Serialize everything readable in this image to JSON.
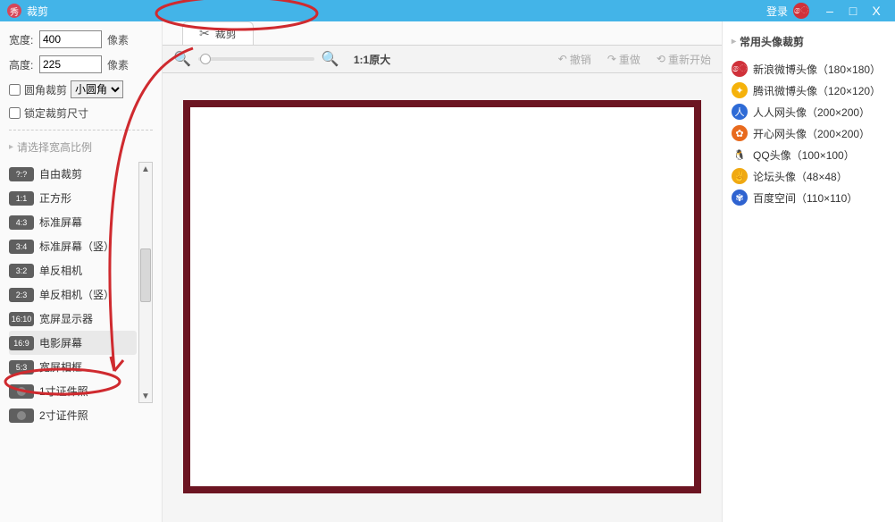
{
  "titleBar": {
    "appTitle": "裁剪",
    "login": "登录"
  },
  "winBtns": {
    "min": "–",
    "max": "□",
    "close": "X"
  },
  "left": {
    "width": {
      "label": "宽度:",
      "value": "400",
      "unit": "像素"
    },
    "height": {
      "label": "高度:",
      "value": "225",
      "unit": "像素"
    },
    "roundCorner": {
      "label": "圆角裁剪",
      "selectValue": "小圆角"
    },
    "lock": {
      "label": "锁定裁剪尺寸"
    },
    "ratioHead": "请选择宽高比例",
    "ratioItems": [
      {
        "badge": "?:?",
        "label": "自由裁剪",
        "selected": false
      },
      {
        "badge": "1:1",
        "label": "正方形",
        "selected": false
      },
      {
        "badge": "4:3",
        "label": "标准屏幕",
        "selected": false
      },
      {
        "badge": "3:4",
        "label": "标准屏幕（竖）",
        "selected": false
      },
      {
        "badge": "3:2",
        "label": "单反相机",
        "selected": false
      },
      {
        "badge": "2:3",
        "label": "单反相机（竖）",
        "selected": false
      },
      {
        "badge": "16:10",
        "label": "宽屏显示器",
        "selected": false
      },
      {
        "badge": "16:9",
        "label": "电影屏幕",
        "selected": true
      },
      {
        "badge": "5:3",
        "label": "宽屏相框",
        "selected": false
      },
      {
        "badge": "cam",
        "label": "1寸证件照",
        "selected": false
      },
      {
        "badge": "cam",
        "label": "2寸证件照",
        "selected": false
      }
    ]
  },
  "center": {
    "tabLabel": "裁剪",
    "zoomLabel": "1:1原大",
    "undo": "撤销",
    "redo": "重做",
    "restart": "重新开始"
  },
  "right": {
    "head": "常用头像裁剪",
    "presets": [
      {
        "color": "#d0313a",
        "glyph": "ෙ",
        "label": "新浪微博头像（180×180）"
      },
      {
        "color": "#f5b20b",
        "glyph": "✦",
        "label": "腾讯微博头像（120×120）"
      },
      {
        "color": "#2e6bd6",
        "glyph": "人",
        "label": "人人网头像（200×200）"
      },
      {
        "color": "#e86a1e",
        "glyph": "✿",
        "label": "开心网头像（200×200）"
      },
      {
        "color": "#",
        "glyph": "🐧",
        "label": "QQ头像（100×100）"
      },
      {
        "color": "#f0a912",
        "glyph": "✌",
        "label": "论坛头像（48×48）"
      },
      {
        "color": "#2f63d0",
        "glyph": "✾",
        "label": "百度空间（110×110）"
      }
    ]
  }
}
